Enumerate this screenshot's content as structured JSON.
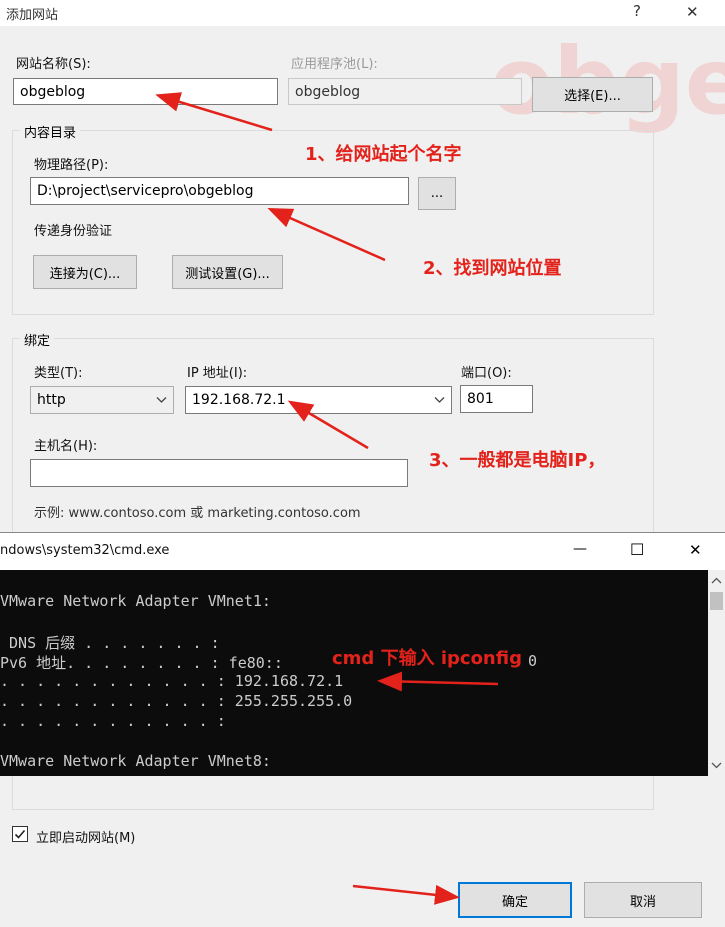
{
  "dialog": {
    "title": "添加网站",
    "help_glyph": "?",
    "close_glyph": "✕",
    "site_name_label": "网站名称(S):",
    "site_name_value": "obgeblog",
    "app_pool_label": "应用程序池(L):",
    "app_pool_value": "obgeblog",
    "select_button": "选择(E)...",
    "content_group": "内容目录",
    "physical_path_label": "物理路径(P):",
    "physical_path_value": "D:\\project\\servicepro\\obgeblog",
    "browse_button": "...",
    "passthrough_label": "传递身份验证",
    "connect_as_button": "连接为(C)...",
    "test_settings_button": "测试设置(G)...",
    "binding_group": "绑定",
    "type_label": "类型(T):",
    "type_value": "http",
    "ip_label": "IP 地址(I):",
    "ip_value": "192.168.72.1",
    "port_label": "端口(O):",
    "port_value": "801",
    "hostname_label": "主机名(H):",
    "hostname_value": "",
    "example_text": "示例: www.contoso.com 或 marketing.contoso.com",
    "start_now_label": "立即启动网站(M)",
    "start_now_checked": true,
    "ok_button": "确定",
    "cancel_button": "取消"
  },
  "watermark": "obge",
  "annotations": {
    "step1": "1、给网站起个名字",
    "step2": "2、找到网站位置",
    "step3": "3、一般都是电脑IP，",
    "cmd_note": "cmd  下输入 ipconfig",
    "arrow_color": "#e2221b"
  },
  "cmd_window": {
    "title": "ndows\\system32\\cmd.exe",
    "min_glyph": "—",
    "max_glyph": "☐",
    "close_glyph": "✕",
    "lines": [
      "VMware Network Adapter VMnet1:",
      "",
      " DNS 后缀 . . . . . . . :",
      "Pv6 地址. . . . . . . . : fe80::",
      ". . . . . . . . . . . . : 192.168.72.1",
      ". . . . . . . . . . . . : 255.255.255.0",
      ". . . . . . . . . . . . :",
      "",
      "VMware Network Adapter VMnet8:"
    ],
    "partial_trailing": "0"
  }
}
